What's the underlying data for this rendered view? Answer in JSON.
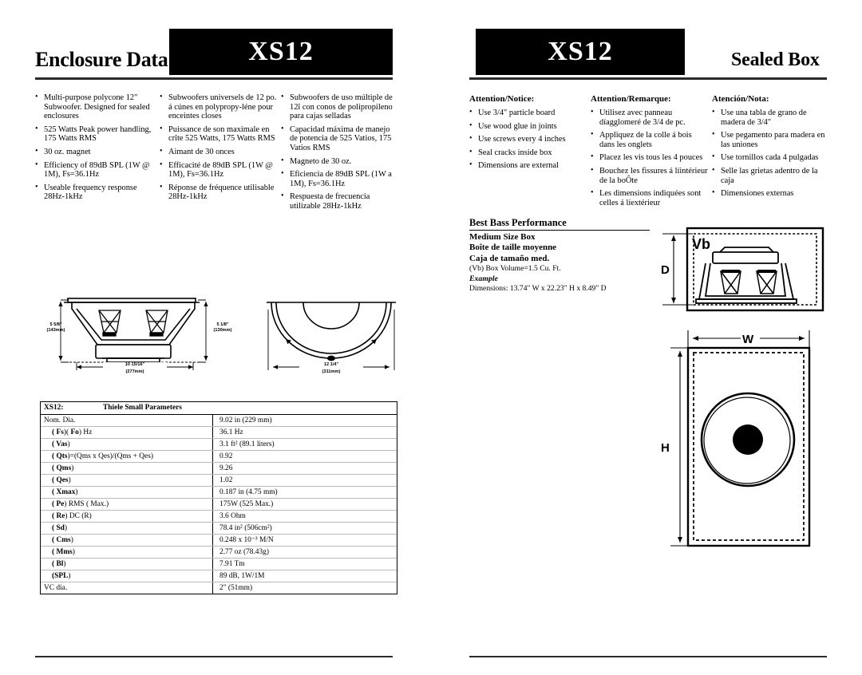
{
  "left_page": {
    "title": "Enclosure Data",
    "model_badge": "XS12",
    "features_en": [
      "Multi-purpose polycone 12\" Subwoofer. Designed for sealed enclosures",
      "525 Watts Peak power handling, 175 Watts RMS",
      "30 oz. magnet",
      "Efficiency of 89dB SPL (1W @ 1M), Fs=36.1Hz",
      "Useable frequency response 28Hz-1kHz"
    ],
    "features_fr": [
      "Subwoofers universels de 12 po. á cúnes en polypropy-léne pour enceintes closes",
      "Puissance de son maximale en crîte 525  Watts, 175 Watts RMS",
      "Aimant de 30 onces",
      "Efficacité de 89dB SPL (1W @ 1M), Fs=36.1Hz",
      "Réponse de fréquence utilisable 28Hz-1kHz"
    ],
    "features_es": [
      "Subwoofers de uso múltiple de 12î con conos de polipropileno para cajas selladas",
      "Capacidad máxima de manejo de potencia de 525 Vatios, 175 Vatios RMS",
      "Magneto de 30 oz.",
      "Eficiencia de 89dB SPL (1W a 1M), Fs=36.1Hz",
      "Respuesta de frecuencia utilizable 28Hz-1kHz"
    ],
    "drawing_side": {
      "left_dim": "5 5/8\"",
      "left_dim_metric": "(143mm)",
      "right_dim": "5 1/8\"",
      "right_dim_metric": "(130mm)",
      "bottom_dim": "10 15/16\"",
      "bottom_dim_metric": "(277mm)"
    },
    "drawing_front": {
      "bottom_dim": "12 1/4\"",
      "bottom_dim_metric": "(311mm)"
    },
    "table": {
      "header_model": "XS12:",
      "header_title": "Thiele Small Parameters",
      "rows": [
        {
          "label": "Nom. Dia.",
          "value": "9.02 in (229 mm)",
          "indent": false,
          "bold_prefix": ""
        },
        {
          "label": ")( ",
          "value": "36.1 Hz",
          "indent": true,
          "bold_prefix": "( Fs",
          "bold_mid": "Fo",
          "suffix": ") Hz",
          "style": "fs"
        },
        {
          "label": "",
          "value": "3.1 ft² (89.1 liters)",
          "indent": true,
          "bold_prefix": "( Vas",
          "suffix": ")"
        },
        {
          "label": "",
          "value": "0.92",
          "indent": true,
          "bold_prefix": "( Qts",
          "suffix": ")=(Qms x Qes)/(Qms + Qes)"
        },
        {
          "label": "",
          "value": "9.26",
          "indent": true,
          "bold_prefix": "( Qms",
          "suffix": ")"
        },
        {
          "label": "",
          "value": "1.02",
          "indent": true,
          "bold_prefix": "( Qes",
          "suffix": ")"
        },
        {
          "label": "",
          "value": "0.187 in (4.75 mm)",
          "indent": true,
          "bold_prefix": "( Xmax",
          "suffix": ")"
        },
        {
          "label": "",
          "value": "175W (525 Max.)",
          "indent": true,
          "bold_prefix": "( Pe",
          "suffix": ") RMS ( Max.)"
        },
        {
          "label": "",
          "value": "3.6  Ohm",
          "indent": true,
          "bold_prefix": "( Re",
          "suffix": ") DC (R)"
        },
        {
          "label": "",
          "value": "78.4 in² (506cm²)",
          "indent": true,
          "bold_prefix": "( Sd",
          "suffix": ")"
        },
        {
          "label": "",
          "value": "0.248 x 10⁻³ M/N",
          "indent": true,
          "bold_prefix": "( Cms",
          "suffix": ")"
        },
        {
          "label": "",
          "value": "2.77 oz (78.43g)",
          "indent": true,
          "bold_prefix": "( Mms",
          "suffix": ")"
        },
        {
          "label": "",
          "value": "7.91 Tm",
          "indent": true,
          "bold_prefix": "( Bl",
          "suffix": ")"
        },
        {
          "label": "",
          "value": "89 dB, 1W/1M",
          "indent": true,
          "bold_prefix": "(SPL",
          "suffix": ")"
        },
        {
          "label": "VC dia.",
          "value": "2\" (51mm)",
          "indent": false,
          "bold_prefix": ""
        }
      ]
    }
  },
  "right_page": {
    "model_badge": "XS12",
    "title": "Sealed Box",
    "notice_en": {
      "heading": "Attention/Notice:",
      "items": [
        "Use 3/4\" particle board",
        "Use wood glue in joints",
        "Use screws every 4 inches",
        "Seal cracks inside box",
        "Dimensions are external"
      ]
    },
    "notice_fr": {
      "heading": "Attention/Remarque:",
      "items": [
        "Utilisez avec panneau díagglomeré de 3/4 de pc.",
        "Appliquez de la colle á bois dans les onglets",
        "Placez les vis tous les 4 pouces",
        "Bouchez les fissures á líintérieur de la boÔte",
        "Les dimensions indiquées sont celles á líextérieur"
      ]
    },
    "notice_es": {
      "heading": "Atención/Nota:",
      "items": [
        "Use una tabla de grano de madera de 3/4\"",
        "Use pegamento para madera en las uniones",
        "Use tornillos cada 4 pulgadas",
        "Selle las grietas adentro de la caja",
        "Dimensiones externas"
      ]
    },
    "best_bass": {
      "title": "Best Bass Performance",
      "size_en": "Medium Size Box",
      "size_fr": "Boîte de taille moyenne",
      "size_es": "Caja de tamaño med.",
      "volume": "(Vb) Box Volume=1.5 Cu. Ft.",
      "example_label": "Example",
      "dimensions": "Dimensions: 13.74\" W x 22.23\" H x 8.49\" D"
    },
    "box_cutaway": {
      "volume_label": "Vb",
      "depth_label": "D"
    },
    "box_front": {
      "width_label": "W",
      "height_label": "H"
    }
  },
  "colors": {
    "ink": "#000000",
    "rule": "#2b2b2b",
    "table_hairline": "#b9b9b9"
  }
}
